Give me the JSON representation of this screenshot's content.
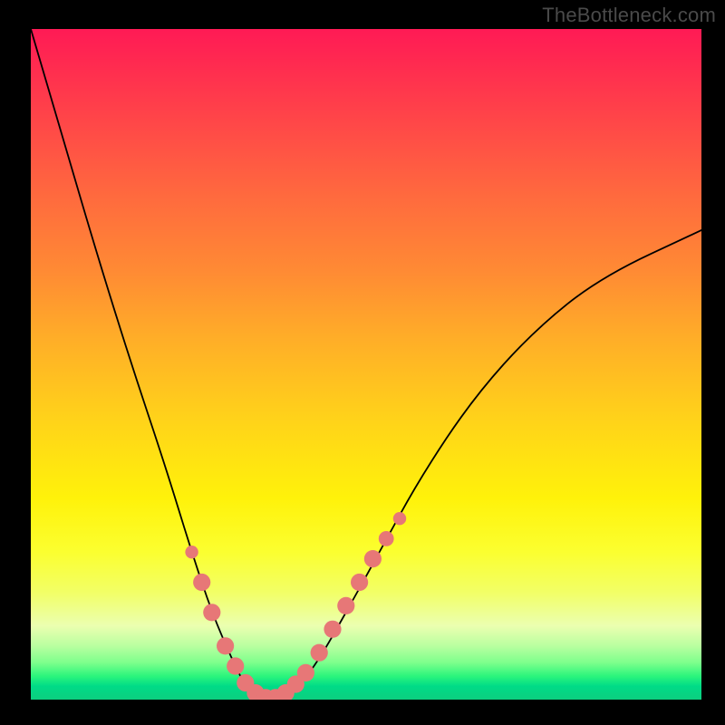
{
  "watermark": "TheBottleneck.com",
  "colors": {
    "frame_bg": "#000000",
    "curve": "#000000",
    "dot": "#e77777",
    "gradient_top": "#ff1a55",
    "gradient_mid": "#ffd21a",
    "gradient_bottom": "#0ccf7f"
  },
  "chart_data": {
    "type": "line",
    "title": "",
    "xlabel": "",
    "ylabel": "",
    "xlim": [
      0,
      100
    ],
    "ylim": [
      0,
      100
    ],
    "series": [
      {
        "name": "bottleneck-curve",
        "x": [
          0,
          5,
          10,
          15,
          20,
          24,
          27,
          30,
          32,
          34,
          36,
          38,
          40,
          43,
          47,
          52,
          58,
          66,
          75,
          85,
          100
        ],
        "y": [
          100,
          83,
          66,
          50,
          35,
          22,
          13,
          6,
          2,
          0,
          0,
          0,
          2,
          6,
          13,
          22,
          33,
          45,
          55,
          63,
          70
        ]
      }
    ],
    "markers": [
      {
        "x": 24.0,
        "y": 22.0,
        "r": 1.2
      },
      {
        "x": 25.5,
        "y": 17.5,
        "r": 1.6
      },
      {
        "x": 27.0,
        "y": 13.0,
        "r": 1.6
      },
      {
        "x": 29.0,
        "y": 8.0,
        "r": 1.6
      },
      {
        "x": 30.5,
        "y": 5.0,
        "r": 1.6
      },
      {
        "x": 32.0,
        "y": 2.5,
        "r": 1.6
      },
      {
        "x": 33.5,
        "y": 1.0,
        "r": 1.6
      },
      {
        "x": 35.0,
        "y": 0.3,
        "r": 1.6
      },
      {
        "x": 36.5,
        "y": 0.3,
        "r": 1.6
      },
      {
        "x": 38.0,
        "y": 1.0,
        "r": 1.6
      },
      {
        "x": 39.5,
        "y": 2.3,
        "r": 1.6
      },
      {
        "x": 41.0,
        "y": 4.0,
        "r": 1.6
      },
      {
        "x": 43.0,
        "y": 7.0,
        "r": 1.6
      },
      {
        "x": 45.0,
        "y": 10.5,
        "r": 1.6
      },
      {
        "x": 47.0,
        "y": 14.0,
        "r": 1.6
      },
      {
        "x": 49.0,
        "y": 17.5,
        "r": 1.6
      },
      {
        "x": 51.0,
        "y": 21.0,
        "r": 1.6
      },
      {
        "x": 53.0,
        "y": 24.0,
        "r": 1.4
      },
      {
        "x": 55.0,
        "y": 27.0,
        "r": 1.2
      }
    ]
  }
}
